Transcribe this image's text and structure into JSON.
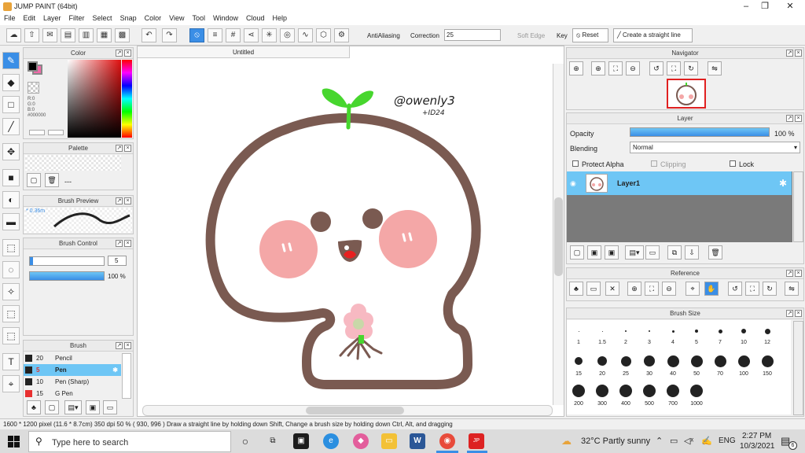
{
  "window": {
    "title": "JUMP PAINT (64bit)"
  },
  "menu": [
    "File",
    "Edit",
    "Layer",
    "Filter",
    "Select",
    "Snap",
    "Color",
    "View",
    "Tool",
    "Window",
    "Cloud",
    "Help"
  ],
  "toolbar": {
    "antialiasing_label": "AntiAliasing",
    "correction_label": "Correction",
    "correction_value": "25",
    "soft_edge_label": "Soft Edge",
    "key_label": "Key",
    "reset_label": "Reset",
    "straight_line_label": "Create a straight line"
  },
  "color_panel": {
    "title": "Color",
    "r": "R:0",
    "g": "G:0",
    "b": "B:0",
    "hex": "#000000",
    "primary_color": "#000000",
    "secondary_color": "#f06aa8"
  },
  "palette_panel": {
    "title": "Palette",
    "dash": "---"
  },
  "brush_preview": {
    "title": "Brush Preview",
    "size": "0.36m"
  },
  "brush_control": {
    "title": "Brush Control",
    "size_value": "5",
    "opacity_value": "100 %"
  },
  "brush_panel": {
    "title": "Brush",
    "items": [
      {
        "size": "20",
        "name": "Pencil",
        "color": "#222222"
      },
      {
        "size": "5",
        "name": "Pen",
        "color": "#222222",
        "selected": true
      },
      {
        "size": "10",
        "name": "Pen (Sharp)",
        "color": "#222222"
      },
      {
        "size": "15",
        "name": "G Pen",
        "color": "#e83030"
      }
    ]
  },
  "canvas": {
    "tab": "Untitled",
    "signature_line1": "@owenly3",
    "signature_line2": "+ID24"
  },
  "navigator": {
    "title": "Navigator"
  },
  "layer_panel": {
    "title": "Layer",
    "opacity_label": "Opacity",
    "opacity_value": "100 %",
    "blending_label": "Blending",
    "blending_value": "Normal",
    "protect_alpha": "Protect Alpha",
    "clipping": "Clipping",
    "lock": "Lock",
    "layer_name": "Layer1"
  },
  "reference_panel": {
    "title": "Reference"
  },
  "brush_size": {
    "title": "Brush Size",
    "sizes": [
      "1",
      "1.5",
      "2",
      "3",
      "4",
      "5",
      "7",
      "10",
      "12",
      "15",
      "20",
      "25",
      "30",
      "40",
      "50",
      "70",
      "100",
      "150",
      "200",
      "300",
      "400",
      "500",
      "700",
      "1000"
    ]
  },
  "status": {
    "text": "1600 * 1200 pixel   (11.6 * 8.7cm)   350 dpi   50 %   ( 930, 996 )   Draw a straight line by holding down Shift, Change a brush size by holding down Ctrl, Alt, and dragging"
  },
  "taskbar": {
    "search_placeholder": "Type here to search",
    "weather": "32°C  Partly sunny",
    "lang": "ENG",
    "time": "2:27 PM",
    "date": "10/3/2021",
    "notifications": "6"
  }
}
